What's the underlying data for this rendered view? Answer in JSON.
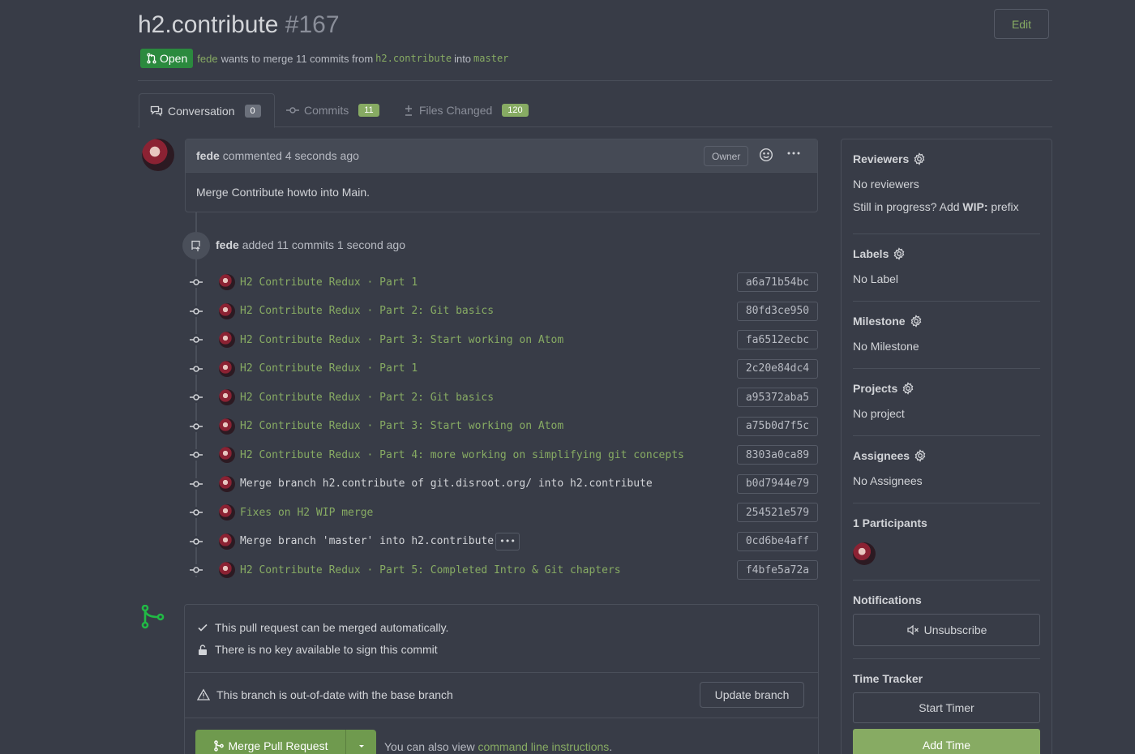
{
  "header": {
    "title": "h2.contribute",
    "number": "#167",
    "edit_label": "Edit",
    "status_label": "Open",
    "author": "fede",
    "merge_text": "wants to merge 11 commits from",
    "head_branch": "h2.contribute",
    "into_text": "into",
    "base_branch": "master"
  },
  "tabs": [
    {
      "label": "Conversation",
      "count": "0"
    },
    {
      "label": "Commits",
      "count": "11"
    },
    {
      "label": "Files Changed",
      "count": "120"
    }
  ],
  "comment": {
    "author": "fede",
    "meta": "commented 4 seconds ago",
    "role": "Owner",
    "body": "Merge Contribute howto into Main."
  },
  "event": {
    "author": "fede",
    "text": "added 11 commits 1 second ago"
  },
  "commits": [
    {
      "message": "H2 Contribute Redux · Part 1",
      "sha": "a6a71b54bc",
      "linked": true
    },
    {
      "message": "H2 Contribute Redux · Part 2: Git basics",
      "sha": "80fd3ce950",
      "linked": true
    },
    {
      "message": "H2 Contribute Redux · Part 3: Start working on Atom",
      "sha": "fa6512ecbc",
      "linked": true
    },
    {
      "message": "H2 Contribute Redux · Part 1",
      "sha": "2c20e84dc4",
      "linked": true
    },
    {
      "message": "H2 Contribute Redux · Part 2: Git basics",
      "sha": "a95372aba5",
      "linked": true
    },
    {
      "message": "H2 Contribute Redux · Part 3: Start working on Atom",
      "sha": "a75b0d7f5c",
      "linked": true
    },
    {
      "message": "H2 Contribute Redux · Part 4: more working on simplifying git concepts",
      "sha": "8303a0ca89",
      "linked": true
    },
    {
      "message": "Merge branch h2.contribute of git.disroot.org/ into h2.contribute",
      "sha": "b0d7944e79",
      "linked": false
    },
    {
      "message": "Fixes on H2 WIP merge",
      "sha": "254521e579",
      "linked": true
    },
    {
      "message": "Merge branch 'master' into h2.contribute",
      "sha": "0cd6be4aff",
      "linked": false,
      "has_more": true
    },
    {
      "message": "H2 Contribute Redux · Part 5: Completed Intro & Git chapters",
      "sha": "f4bfe5a72a",
      "linked": true
    }
  ],
  "commit_more_label": "•••",
  "merge_box": {
    "auto_merge": "This pull request can be merged automatically.",
    "no_key": "There is no key available to sign this commit",
    "out_of_date": "This branch is out-of-date with the base branch",
    "update_label": "Update branch",
    "merge_label": "Merge Pull Request",
    "cli_prefix": "You can also view",
    "cli_link": "command line instructions",
    "cli_suffix": "."
  },
  "sidebar": {
    "reviewers_title": "Reviewers",
    "reviewers_value": "No reviewers",
    "wip_prefix": "Still in progress? Add",
    "wip_bold": "WIP:",
    "wip_suffix": "prefix",
    "labels_title": "Labels",
    "labels_value": "No Label",
    "milestone_title": "Milestone",
    "milestone_value": "No Milestone",
    "projects_title": "Projects",
    "projects_value": "No project",
    "assignees_title": "Assignees",
    "assignees_value": "No Assignees",
    "participants_title": "1 Participants",
    "notifications_title": "Notifications",
    "unsubscribe_label": "Unsubscribe",
    "time_title": "Time Tracker",
    "start_timer_label": "Start Timer",
    "add_time_label": "Add Time"
  },
  "colors": {
    "background": "#383c47",
    "accent_green": "#87ab63",
    "open_badge": "#2b8a3e",
    "merge_icon": "#21ba45"
  }
}
